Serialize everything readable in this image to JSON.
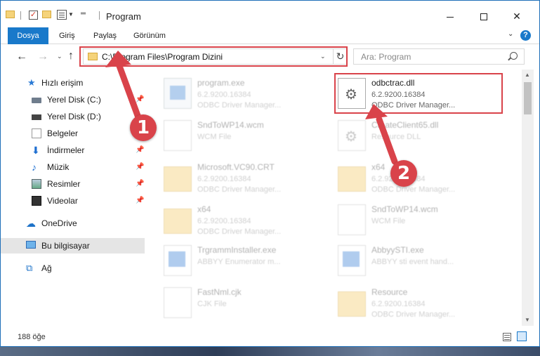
{
  "window": {
    "title": "Program",
    "minimize_icon": "minimize-icon",
    "maximize_icon": "maximize-icon",
    "close_glyph": "✕"
  },
  "ribbon": {
    "tabs": [
      "Dosya",
      "Giriş",
      "Paylaş",
      "Görünüm"
    ],
    "chevron": "⌄",
    "help": "?"
  },
  "nav": {
    "back": "←",
    "forward": "→",
    "recent": "⌄",
    "up": "↑",
    "address": "C:\\Program Files\\Program Dizini",
    "address_caret": "⌄",
    "refresh": "↻",
    "search_placeholder": "Ara: Program"
  },
  "sidebar": {
    "items": [
      {
        "label": "Hızlı erişim",
        "icon": "star-icon"
      },
      {
        "label": "Yerel Disk (C:)",
        "icon": "drive-icon"
      },
      {
        "label": "Yerel Disk (D:)",
        "icon": "drive-icon"
      },
      {
        "label": "Belgeler",
        "icon": "documents-icon"
      },
      {
        "label": "İndirmeler",
        "icon": "download-icon"
      },
      {
        "label": "Müzik",
        "icon": "music-icon"
      },
      {
        "label": "Resimler",
        "icon": "pictures-icon"
      },
      {
        "label": "Videolar",
        "icon": "video-icon"
      },
      {
        "label": "OneDrive",
        "icon": "cloud-icon"
      },
      {
        "label": "Bu bilgisayar",
        "icon": "pc-icon"
      },
      {
        "label": "Ağ",
        "icon": "network-icon"
      }
    ],
    "pin_glyph": "📌"
  },
  "files": [
    {
      "name": "program.exe",
      "meta1": "6.2.9200.16384",
      "meta2": "ODBC Driver Manager...",
      "type": "exe"
    },
    {
      "name": "odbctrac.dll",
      "meta1": "6.2.9200.16384",
      "meta2": "ODBC Driver Manager...",
      "type": "dll"
    },
    {
      "name": "SndToWP14.wcm",
      "meta1": "WCM File",
      "meta2": "",
      "type": "doc"
    },
    {
      "name": "CreateClient65.dll",
      "meta1": "Resource DLL",
      "meta2": "",
      "type": "dll"
    },
    {
      "name": "Microsoft.VC90.CRT",
      "meta1": "6.2.9200.16384",
      "meta2": "ODBC Driver Manager...",
      "type": "folder"
    },
    {
      "name": "x64",
      "meta1": "6.2.9200.16384",
      "meta2": "ODBC Driver Manager...",
      "type": "folder"
    },
    {
      "name": "x64",
      "meta1": "6.2.9200.16384",
      "meta2": "ODBC Driver Manager...",
      "type": "folder"
    },
    {
      "name": "SndToWP14.wcm",
      "meta1": "WCM File",
      "meta2": "",
      "type": "doc"
    },
    {
      "name": "TrgrammInstaller.exe",
      "meta1": "ABBYY Enumerator m...",
      "meta2": "",
      "type": "app"
    },
    {
      "name": "AbbyySTI.exe",
      "meta1": "ABBYY sti event hand...",
      "meta2": "",
      "type": "app"
    },
    {
      "name": "FastNml.cjk",
      "meta1": "CJK File",
      "meta2": "",
      "type": "doc"
    },
    {
      "name": "Resource",
      "meta1": "6.2.9200.16384",
      "meta2": "ODBC Driver Manager...",
      "type": "folder"
    }
  ],
  "status": {
    "count": "188 öğe"
  },
  "annotations": {
    "step1": "1",
    "step2": "2",
    "color": "#d9434a"
  }
}
